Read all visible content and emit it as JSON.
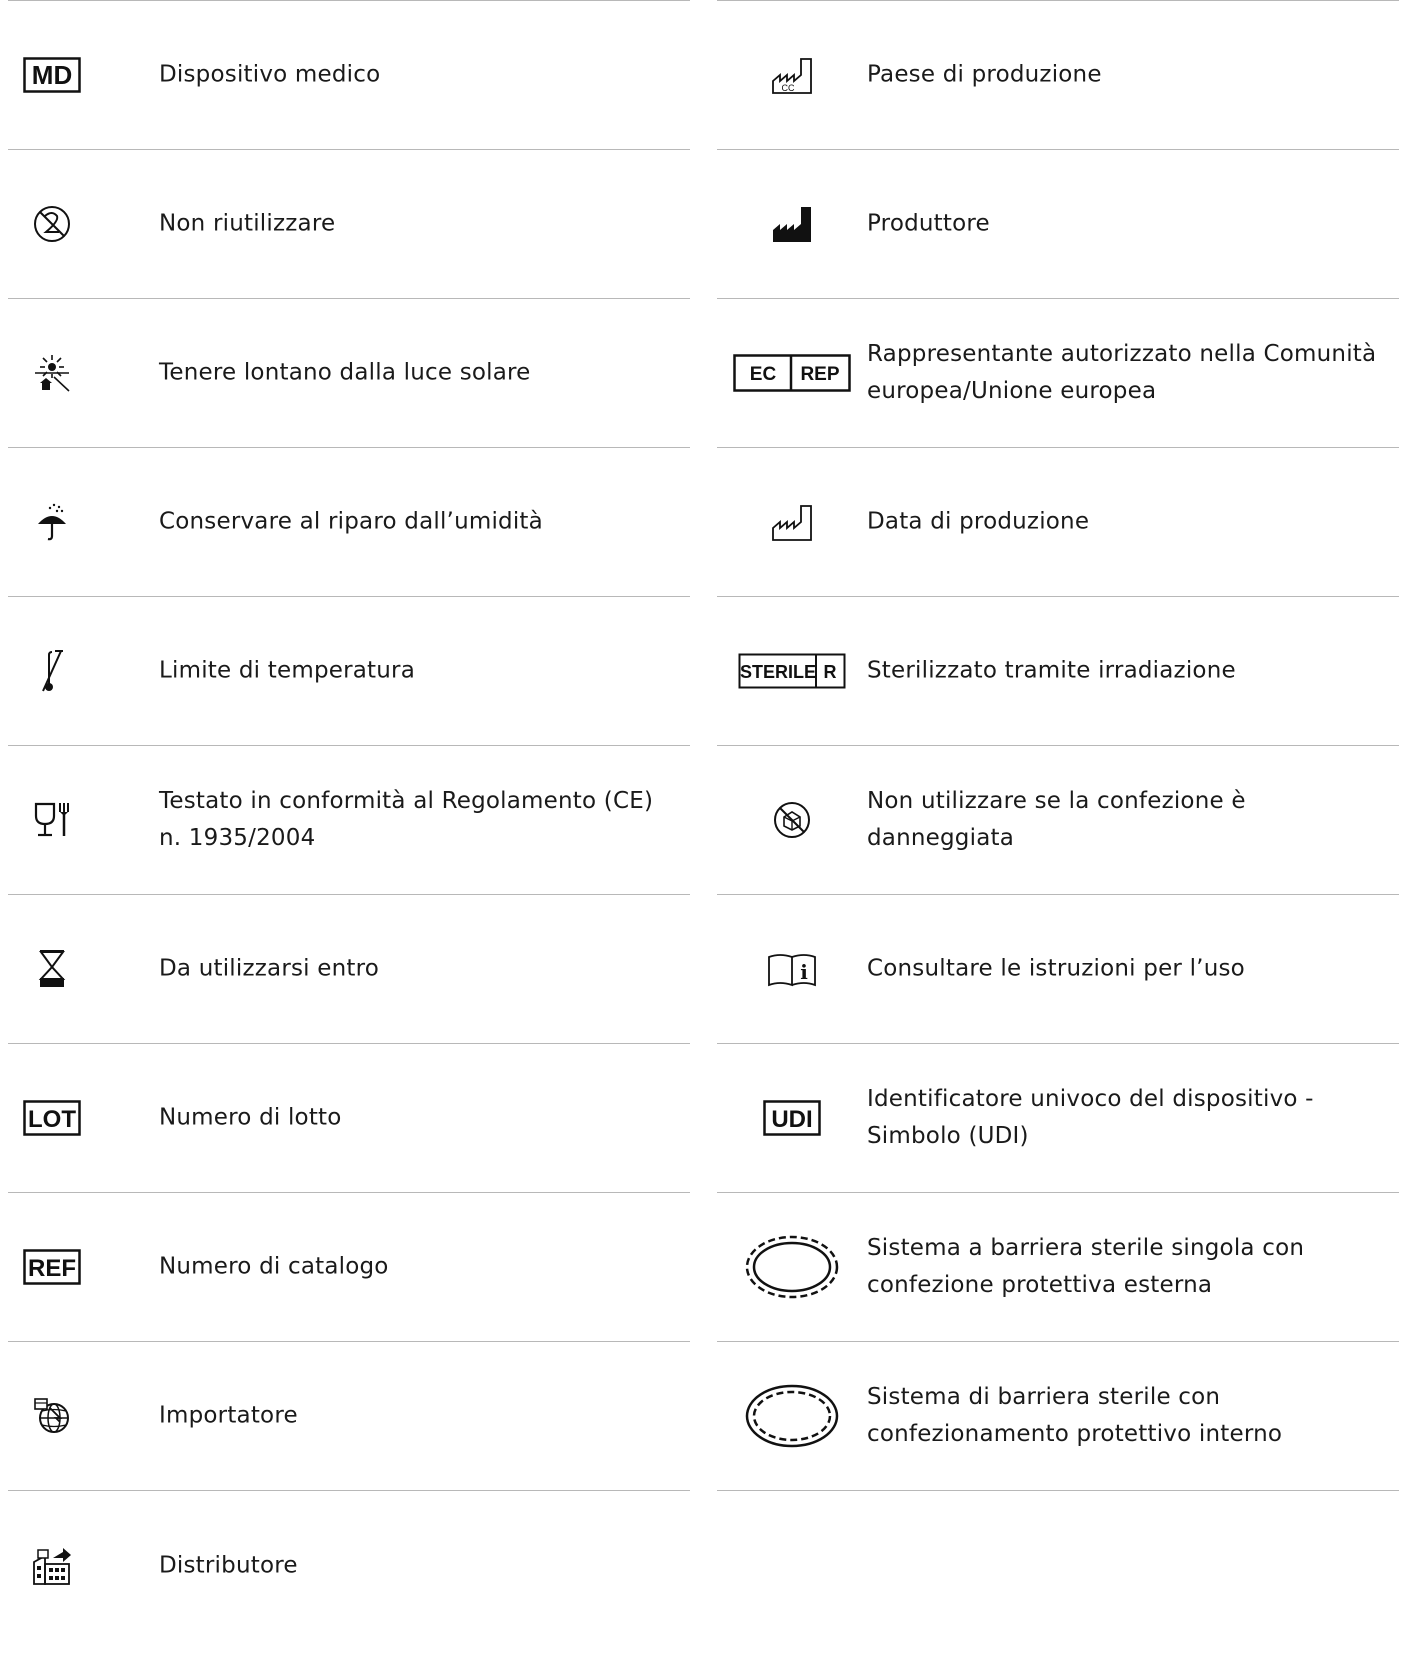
{
  "left": [
    {
      "icon": "md-symbol-icon",
      "icon_text": "MD",
      "label": "Dispositivo medico"
    },
    {
      "icon": "do-not-reuse-icon",
      "label": "Non riutilizzare"
    },
    {
      "icon": "keep-away-from-sunlight-icon",
      "label": "Tenere lontano dalla luce solare"
    },
    {
      "icon": "keep-dry-umbrella-icon",
      "label": "Conservare al riparo dall’umidità"
    },
    {
      "icon": "temperature-limit-icon",
      "label": "Limite di temperatura"
    },
    {
      "icon": "food-contact-glass-fork-icon",
      "label": "Testato in conformità al Regolamento (CE) n. 1935/2004"
    },
    {
      "icon": "use-by-hourglass-icon",
      "label": "Da utilizzarsi entro"
    },
    {
      "icon": "lot-symbol-icon",
      "icon_text": "LOT",
      "label": "Numero di lotto"
    },
    {
      "icon": "ref-symbol-icon",
      "icon_text": "REF",
      "label": "Numero di catalogo"
    },
    {
      "icon": "importer-icon",
      "label": "Importatore"
    },
    {
      "icon": "distributor-icon",
      "label": "Distributore"
    }
  ],
  "right": [
    {
      "icon": "country-of-manufacture-icon",
      "icon_text": "CC",
      "label": "Paese di produzione"
    },
    {
      "icon": "manufacturer-factory-icon",
      "label": "Produttore"
    },
    {
      "icon": "ec-rep-icon",
      "icon_text": [
        "EC",
        "REP"
      ],
      "label": "Rappresentante autorizzato nella Comunità europea/Unione europea"
    },
    {
      "icon": "date-of-manufacture-icon",
      "label": "Data di produzione"
    },
    {
      "icon": "sterile-r-icon",
      "icon_text": [
        "STERILE",
        "R"
      ],
      "label": "Sterilizzato tramite irradiazione"
    },
    {
      "icon": "do-not-use-if-damaged-icon",
      "label": "Non utilizzare se la confezione è danneggiata"
    },
    {
      "icon": "consult-instructions-icon",
      "icon_text": "i",
      "label": "Consultare le istruzioni per l’uso"
    },
    {
      "icon": "udi-symbol-icon",
      "icon_text": "UDI",
      "label": "Identificatore univoco del dispositivo - Simbolo (UDI)"
    },
    {
      "icon": "single-sterile-barrier-outer-icon",
      "label": "Sistema a barriera sterile singola con confezione protettiva esterna"
    },
    {
      "icon": "sterile-barrier-inner-icon",
      "label": "Sistema di barriera sterile con confezionamento protettivo interno"
    }
  ]
}
